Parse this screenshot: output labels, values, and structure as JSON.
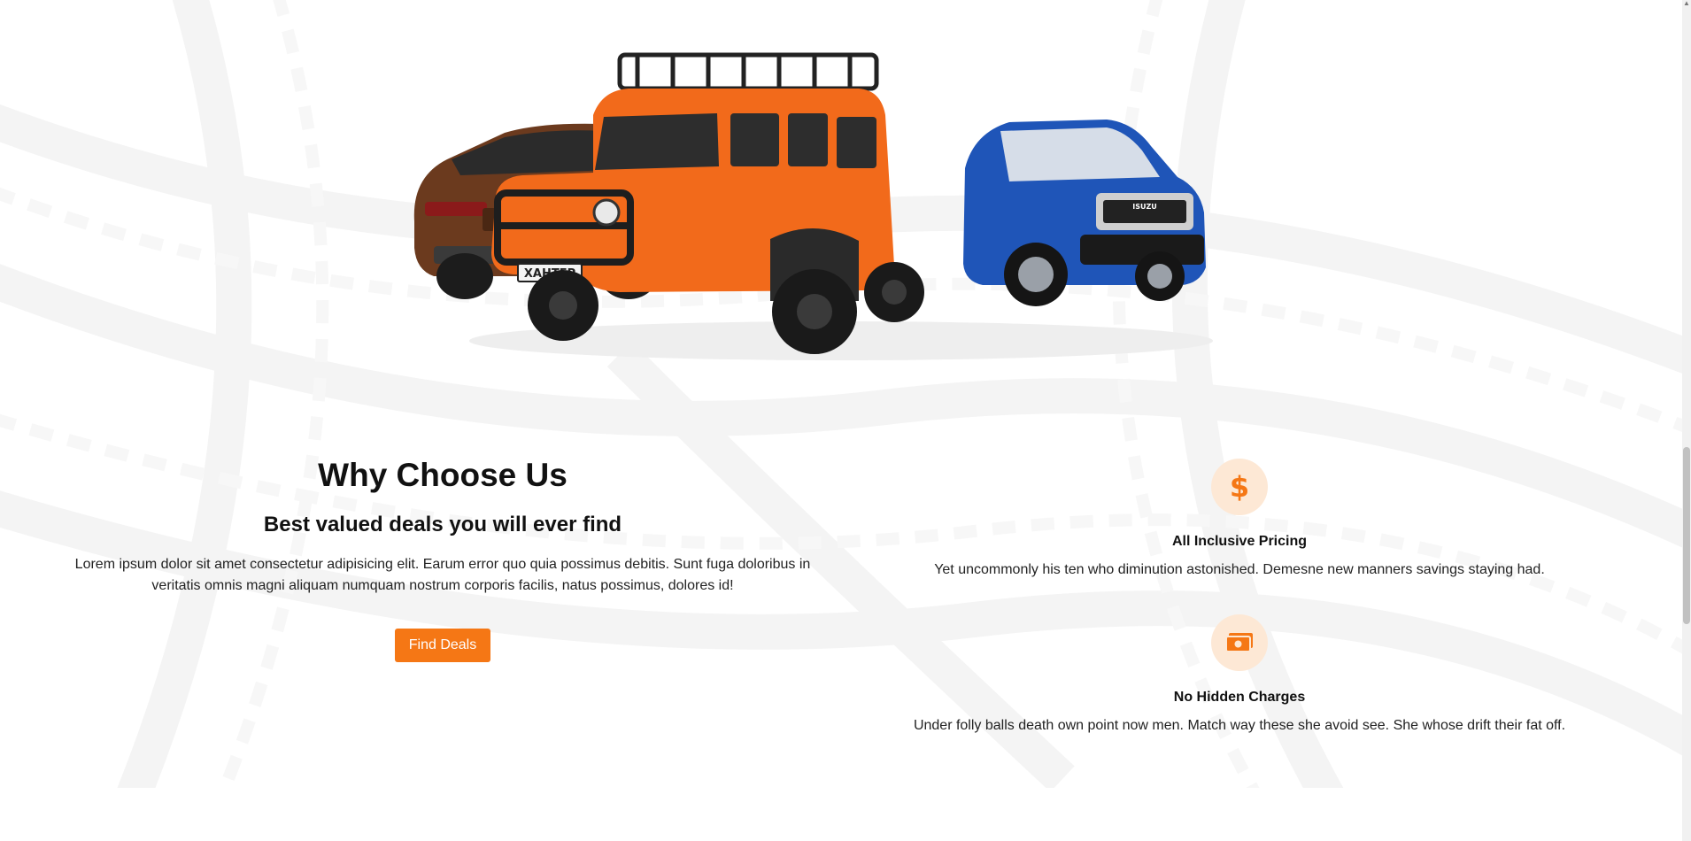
{
  "why_section": {
    "title": "Why Choose Us",
    "subtitle": "Best valued deals you will ever find",
    "description": "Lorem ipsum dolor sit amet consectetur adipisicing elit. Earum error quo quia possimus debitis. Sunt fuga doloribus in veritatis omnis magni aliquam numquam nostrum corporis facilis, natus possimus, dolores id!",
    "button_label": "Find Deals"
  },
  "features": [
    {
      "icon": "dollar-icon",
      "title": "All Inclusive Pricing",
      "description": "Yet uncommonly his ten who diminution astonished. Demesne new manners savings staying had."
    },
    {
      "icon": "money-bill-icon",
      "title": "No Hidden Charges",
      "description": "Under folly balls death own point now men. Match way these she avoid see. She whose drift their fat off."
    }
  ],
  "hero": {
    "plate_text": "ХАНТЕР",
    "brand_badge": "ISUZU"
  },
  "colors": {
    "accent": "#f57715",
    "icon_bg": "#fde8d5"
  }
}
